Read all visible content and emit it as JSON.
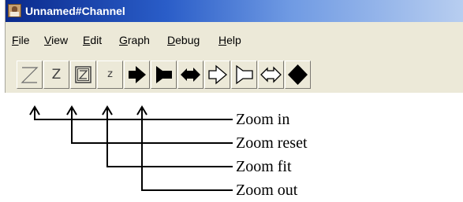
{
  "window": {
    "title": "Unnamed#Channel"
  },
  "menu": {
    "items": [
      "File",
      "View",
      "Edit",
      "Graph",
      "Debug",
      "Help"
    ]
  },
  "toolbar": {
    "zoom_in_glyph": "Z",
    "zoom_reset_glyph": "Z",
    "zoom_fit_glyph": "Z",
    "zoom_out_glyph": "z",
    "icons": [
      "zoom-in-icon",
      "zoom-reset-icon",
      "zoom-fit-icon",
      "zoom-out-icon",
      "arrow-right-filled-icon",
      "flag-filled-icon",
      "arrow-double-filled-icon",
      "arrow-right-outline-icon",
      "flag-outline-icon",
      "arrow-double-outline-icon",
      "diamond-filled-icon"
    ]
  },
  "annotations": {
    "zoom_in": "Zoom in",
    "zoom_reset": "Zoom reset",
    "zoom_fit": "Zoom fit",
    "zoom_out": "Zoom out"
  }
}
